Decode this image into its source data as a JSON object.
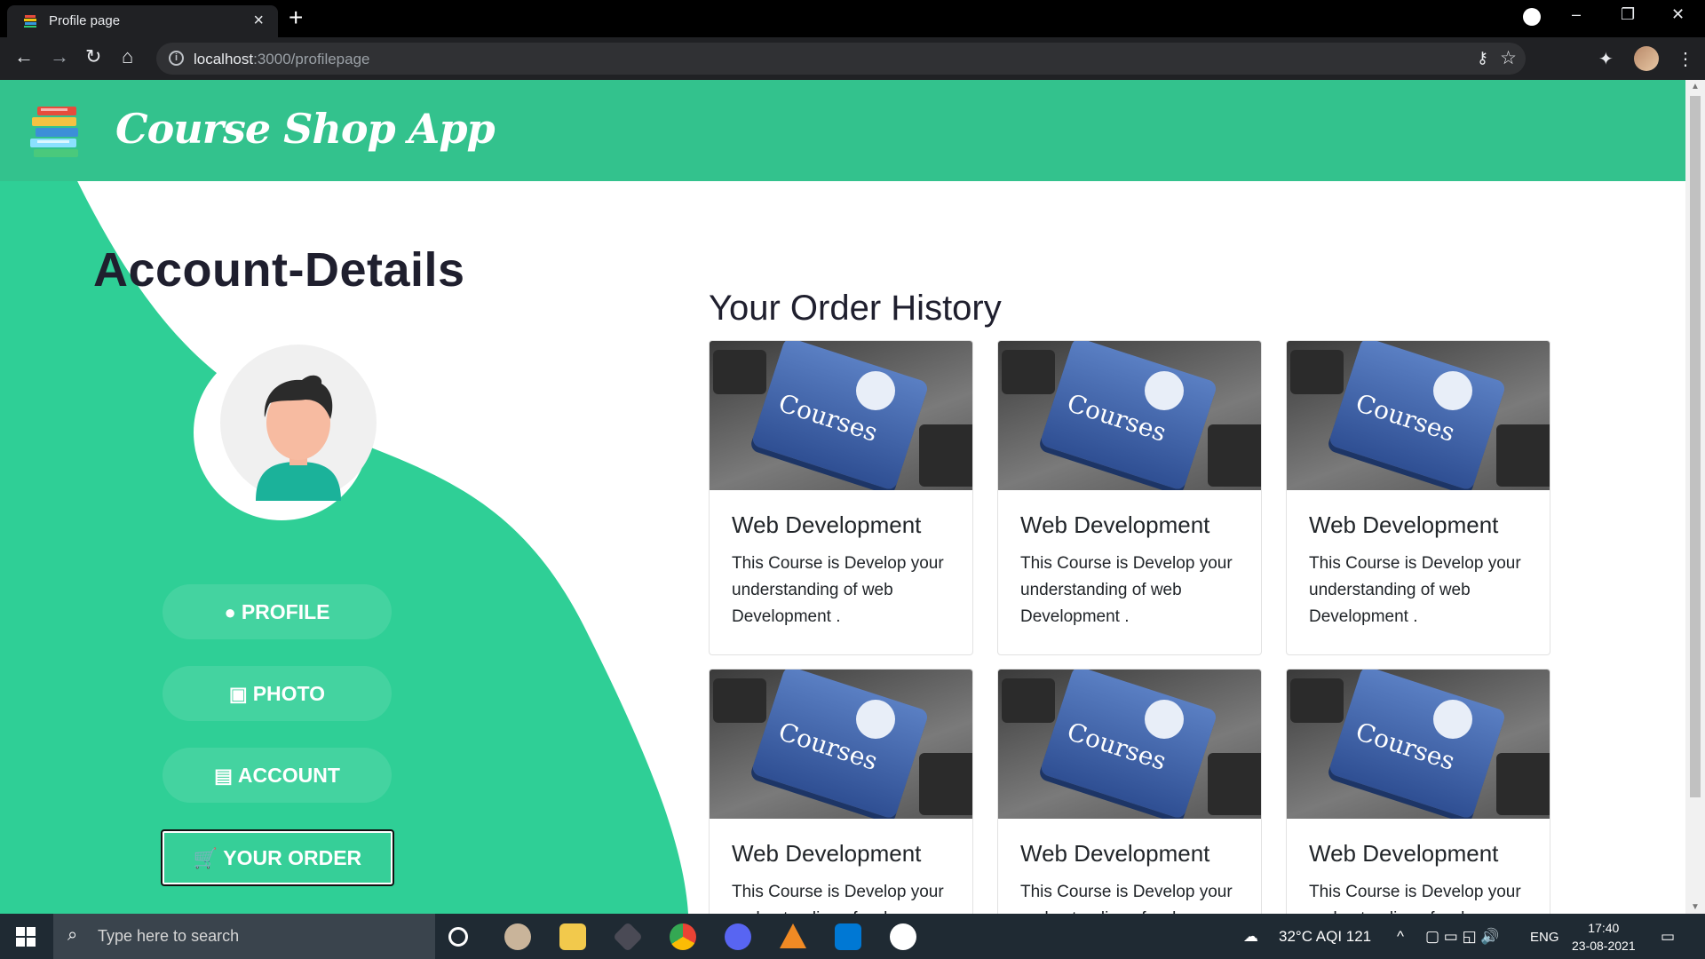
{
  "browser": {
    "tab_title": "Profile page",
    "url_host": "localhost",
    "url_path": ":3000/profilepage"
  },
  "header": {
    "brand": "Course Shop App"
  },
  "sidebar": {
    "title": "Account-Details",
    "menu": [
      {
        "label": "PROFILE",
        "icon": "user-circle-icon"
      },
      {
        "label": "PHOTO",
        "icon": "id-badge-icon"
      },
      {
        "label": "ACCOUNT",
        "icon": "id-card-icon"
      },
      {
        "label": "YOUR ORDER",
        "icon": "cart-icon",
        "active": true
      }
    ]
  },
  "orders": {
    "title": "Your Order History",
    "cards": [
      {
        "image_text": "Courses",
        "title": "Web Development",
        "description": "This Course is Develop your understanding of web Development ."
      },
      {
        "image_text": "Courses",
        "title": "Web Development",
        "description": "This Course is Develop your understanding of web Development ."
      },
      {
        "image_text": "Courses",
        "title": "Web Development",
        "description": "This Course is Develop your understanding of web Development ."
      },
      {
        "image_text": "Courses",
        "title": "Web Development",
        "description": "This Course is Develop your understanding of web Development ."
      },
      {
        "image_text": "Courses",
        "title": "Web Development",
        "description": "This Course is Develop your understanding of web Development ."
      },
      {
        "image_text": "Courses",
        "title": "Web Development",
        "description": "This Course is Develop your understanding of web Development ."
      }
    ]
  },
  "taskbar": {
    "search_placeholder": "Type here to search",
    "weather": "32°C  AQI 121",
    "language": "ENG",
    "time": "17:40",
    "date": "23-08-2021"
  },
  "colors": {
    "brand_green": "#33c28d",
    "active_green": "#36cf98"
  }
}
